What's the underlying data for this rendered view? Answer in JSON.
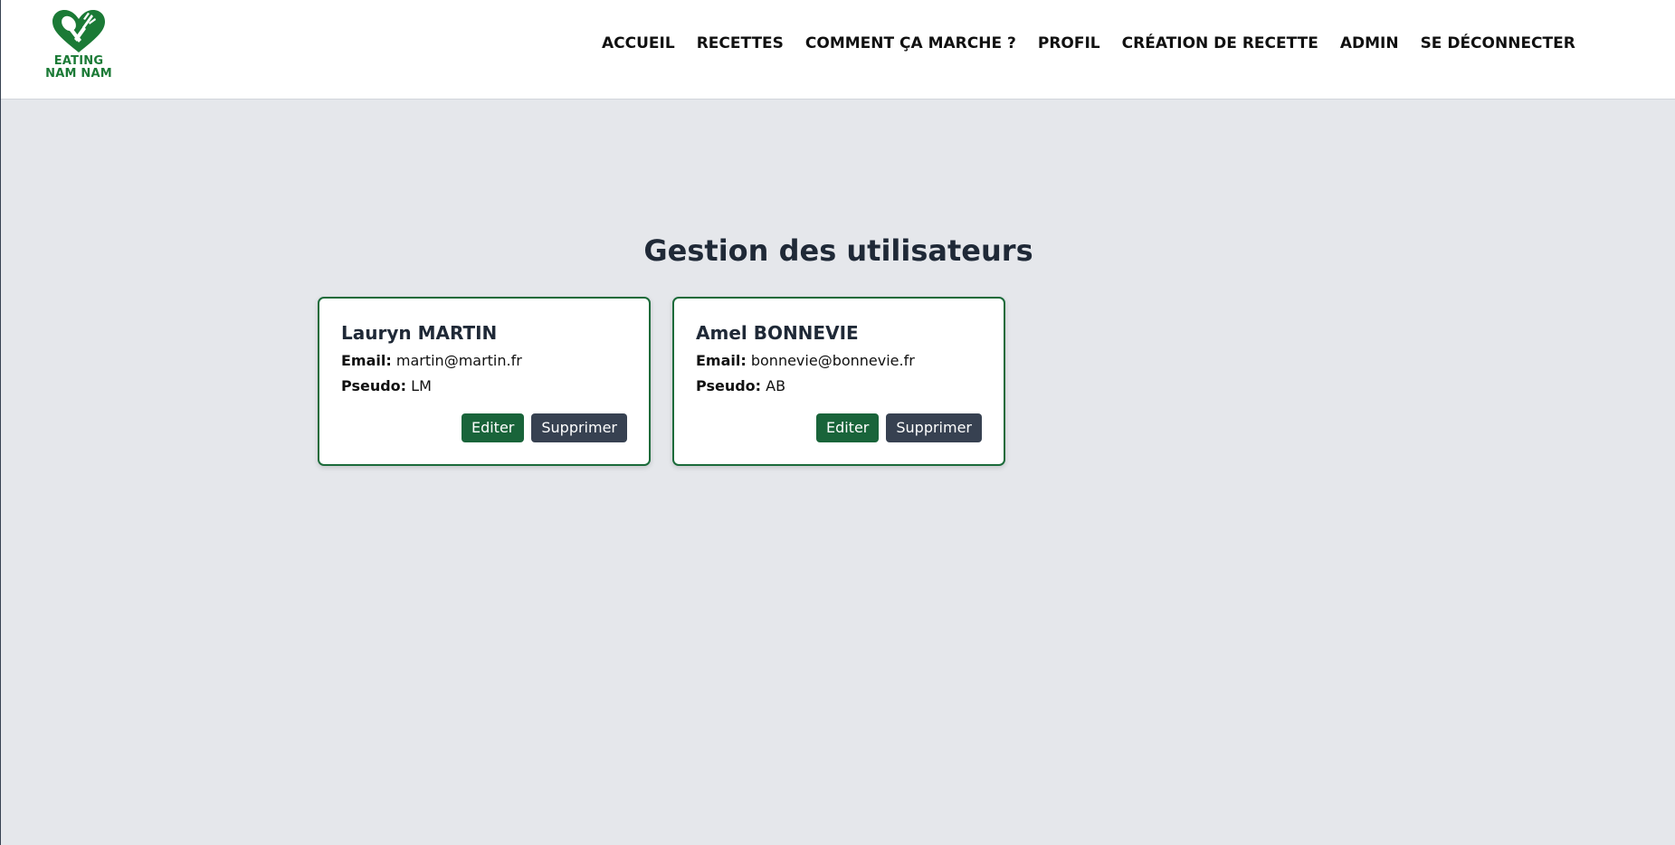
{
  "brand": {
    "logo_line1": "EATING",
    "logo_line2": "NAM NAM",
    "color": "#1b7a36",
    "icon": "heart-spoon-fork-icon"
  },
  "nav": {
    "items": [
      {
        "label": "ACCUEIL"
      },
      {
        "label": "RECETTES"
      },
      {
        "label": "COMMENT ÇA MARCHE ?"
      },
      {
        "label": "PROFIL"
      },
      {
        "label": "CRÉATION DE RECETTE"
      },
      {
        "label": "ADMIN"
      },
      {
        "label": "SE DÉCONNECTER"
      }
    ]
  },
  "main": {
    "title": "Gestion des utilisateurs",
    "users": [
      {
        "name": "Lauryn MARTIN",
        "email_label": "Email:",
        "email": "martin@martin.fr",
        "pseudo_label": "Pseudo:",
        "pseudo": "LM",
        "edit_label": "Editer",
        "delete_label": "Supprimer"
      },
      {
        "name": "Amel BONNEVIE",
        "email_label": "Email:",
        "email": "bonnevie@bonnevie.fr",
        "pseudo_label": "Pseudo:",
        "pseudo": "AB",
        "edit_label": "Editer",
        "delete_label": "Supprimer"
      }
    ]
  },
  "colors": {
    "accent_green": "#19643a",
    "dark_button": "#374151",
    "background": "#e5e7eb",
    "card_border": "#1b6b3a"
  }
}
